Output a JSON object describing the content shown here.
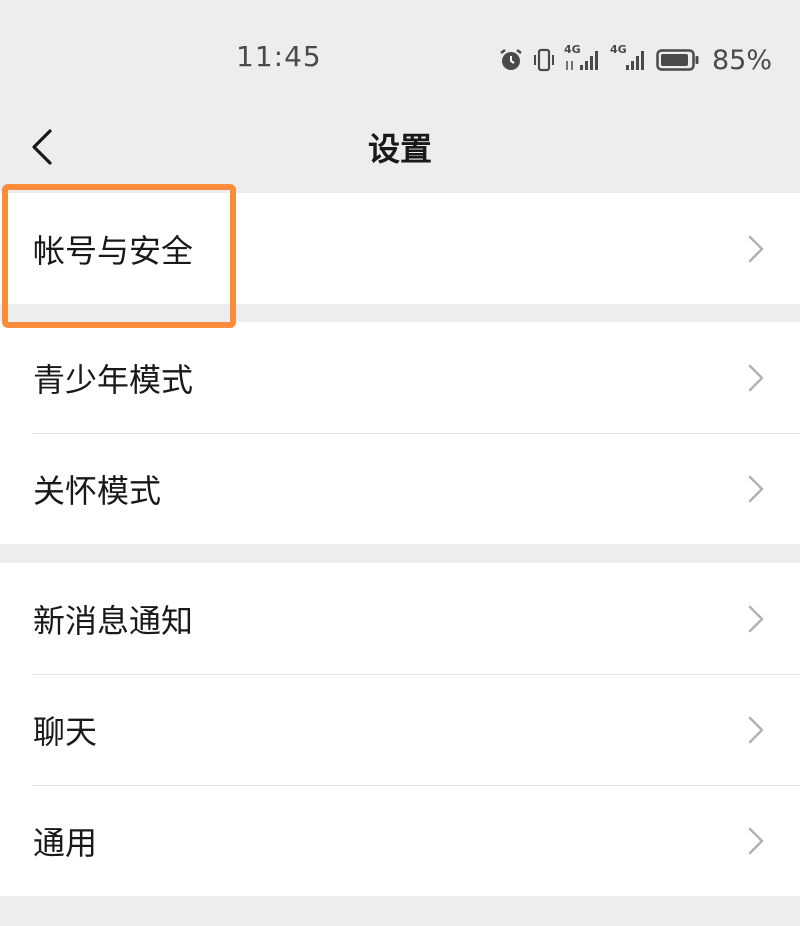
{
  "status_bar": {
    "time": "11:45",
    "battery_percent": "85%",
    "icons": [
      "alarm-icon",
      "vibrate-icon",
      "signal-4g-icon",
      "signal-4g-icon",
      "battery-icon"
    ],
    "network_label": "4G"
  },
  "nav": {
    "title": "设置",
    "back_icon": "chevron-left-icon"
  },
  "groups": [
    {
      "items": [
        {
          "label": "帐号与安全"
        }
      ]
    },
    {
      "items": [
        {
          "label": "青少年模式"
        },
        {
          "label": "关怀模式"
        }
      ]
    },
    {
      "items": [
        {
          "label": "新消息通知"
        },
        {
          "label": "聊天"
        },
        {
          "label": "通用"
        }
      ]
    }
  ],
  "colors": {
    "background": "#ededed",
    "card": "#ffffff",
    "divider": "#e6e6e6",
    "highlight": "#fb8c3c",
    "chevron": "#b2b2b2"
  }
}
